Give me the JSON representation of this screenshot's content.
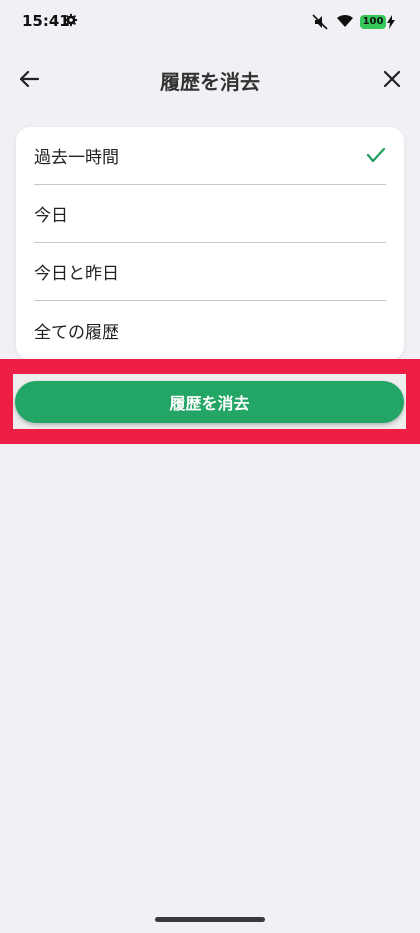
{
  "status_bar": {
    "time": "15:41",
    "battery_level": "100",
    "icons": [
      "gear-icon",
      "mute-icon",
      "wifi-icon",
      "battery-icon",
      "charging-bolt-icon"
    ]
  },
  "nav": {
    "title": "履歴を消去",
    "back_icon": "back-arrow-icon",
    "close_icon": "close-icon"
  },
  "options": [
    {
      "label": "過去一時間",
      "selected": true
    },
    {
      "label": "今日",
      "selected": false
    },
    {
      "label": "今日と昨日",
      "selected": false
    },
    {
      "label": "全ての履歴",
      "selected": false
    }
  ],
  "actions": {
    "clear_label": "履歴を消去"
  },
  "colors": {
    "accent": "#22a565",
    "check": "#1f9e5f",
    "highlight": "#ed1f45",
    "background": "#f1f0f5"
  }
}
